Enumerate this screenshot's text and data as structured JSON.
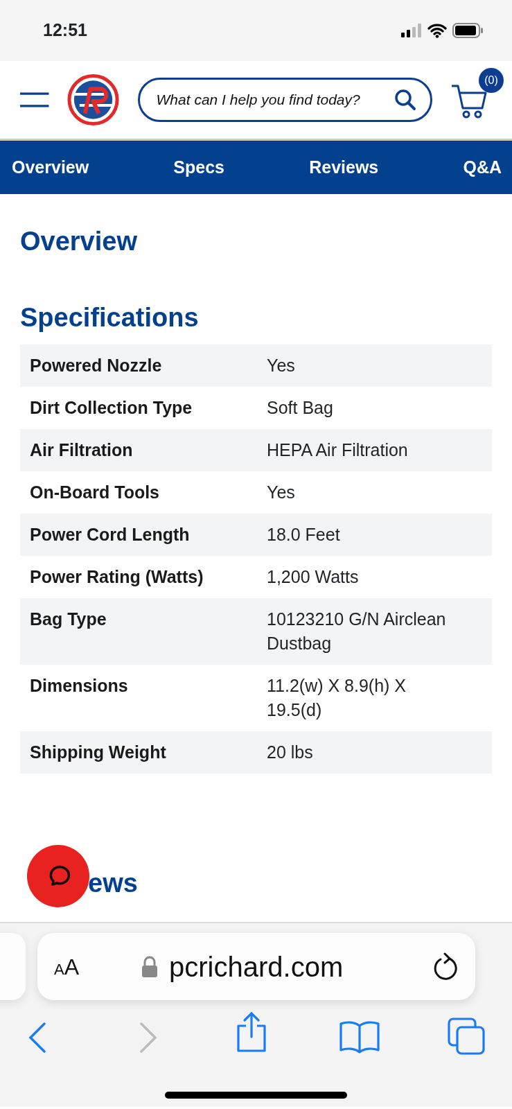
{
  "status_bar": {
    "time": "12:51"
  },
  "header": {
    "search": {
      "placeholder": "What can I help you find today?"
    },
    "cart": {
      "count": "(0)"
    }
  },
  "tabs": [
    {
      "label": "Overview"
    },
    {
      "label": "Specs"
    },
    {
      "label": "Reviews"
    },
    {
      "label": "Q&A"
    }
  ],
  "sections": {
    "overview_title": "Overview",
    "specifications_title": "Specifications",
    "reviews_title_visible": "ews"
  },
  "specs": [
    {
      "name": "Powered Nozzle",
      "value": "Yes"
    },
    {
      "name": "Dirt Collection Type",
      "value": "Soft Bag"
    },
    {
      "name": "Air Filtration",
      "value": "HEPA Air Filtration"
    },
    {
      "name": "On-Board Tools",
      "value": "Yes"
    },
    {
      "name": "Power Cord Length",
      "value": "18.0 Feet"
    },
    {
      "name": "Power Rating (Watts)",
      "value": "1,200 Watts"
    },
    {
      "name": "Bag Type",
      "value": "10123210 G/N Airclean Dustbag"
    },
    {
      "name": "Dimensions",
      "value": "11.2(w) X 8.9(h) X 19.5(d)"
    },
    {
      "name": "Shipping Weight",
      "value": "20 lbs"
    }
  ],
  "browser": {
    "text_size": "AA",
    "url": "pcrichard.com"
  }
}
